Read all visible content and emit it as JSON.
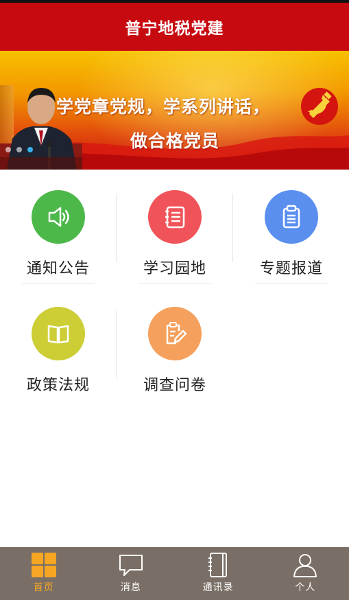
{
  "header": {
    "title": "普宁地税党建"
  },
  "banner": {
    "line1": "学党章党规，学系列讲话，",
    "line2": "做合格党员",
    "slide_count": 3,
    "active_slide": 2
  },
  "menu": {
    "items": [
      {
        "label": "通知公告",
        "icon": "speaker-icon",
        "color": "#4cb84a"
      },
      {
        "label": "学习园地",
        "icon": "notebook-icon",
        "color": "#f0545a"
      },
      {
        "label": "专题报道",
        "icon": "clipboard-icon",
        "color": "#5a8ff0"
      },
      {
        "label": "政策法规",
        "icon": "book-icon",
        "color": "#cdcd36"
      },
      {
        "label": "调查问卷",
        "icon": "survey-edit-icon",
        "color": "#f5a05c"
      }
    ]
  },
  "tabbar": {
    "tabs": [
      {
        "label": "首页",
        "icon": "home-grid-icon",
        "active": true
      },
      {
        "label": "消息",
        "icon": "chat-bubble-icon",
        "active": false
      },
      {
        "label": "通讯录",
        "icon": "contacts-book-icon",
        "active": false
      },
      {
        "label": "个人",
        "icon": "person-icon",
        "active": false
      }
    ],
    "active_color": "#f6a623",
    "background": "#7a6f66"
  },
  "colors": {
    "header_bg": "#c70a10"
  }
}
